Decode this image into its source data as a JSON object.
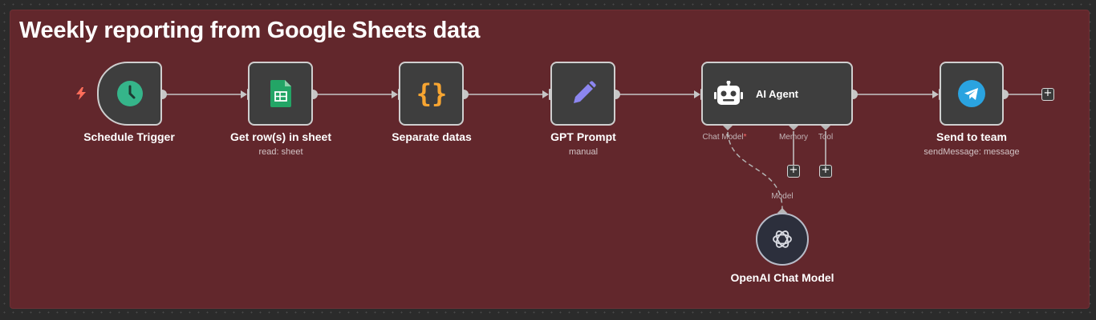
{
  "group": {
    "title": "Weekly reporting from Google Sheets data"
  },
  "nodes": {
    "schedule_trigger": {
      "label": "Schedule Trigger",
      "icon": "clock-icon"
    },
    "get_rows": {
      "label": "Get row(s) in sheet",
      "sublabel": "read: sheet",
      "icon": "google-sheets-icon"
    },
    "separate": {
      "label": "Separate datas",
      "icon": "code-braces-icon"
    },
    "gpt_prompt": {
      "label": "GPT Prompt",
      "sublabel": "manual",
      "icon": "pencil-icon"
    },
    "ai_agent": {
      "label": "AI Agent",
      "icon": "robot-icon",
      "ports": {
        "chat_model": "Chat Model",
        "required_mark": "*",
        "memory": "Memory",
        "tool": "Tool"
      }
    },
    "send_team": {
      "label": "Send to team",
      "sublabel": "sendMessage: message",
      "icon": "telegram-icon"
    },
    "openai": {
      "label": "OpenAI Chat Model",
      "port": "Model",
      "icon": "openai-icon"
    }
  },
  "buttons": {
    "add": "+"
  },
  "colors": {
    "group_bg": "#62272c",
    "node_bg": "#3e3e3e",
    "clock": "#35b58a",
    "sheets": "#23a566",
    "braces": "#f7a531",
    "pencil": "#8c86f0",
    "telegram": "#2aa3e0",
    "trigger_bolt": "#ff6d5a"
  }
}
